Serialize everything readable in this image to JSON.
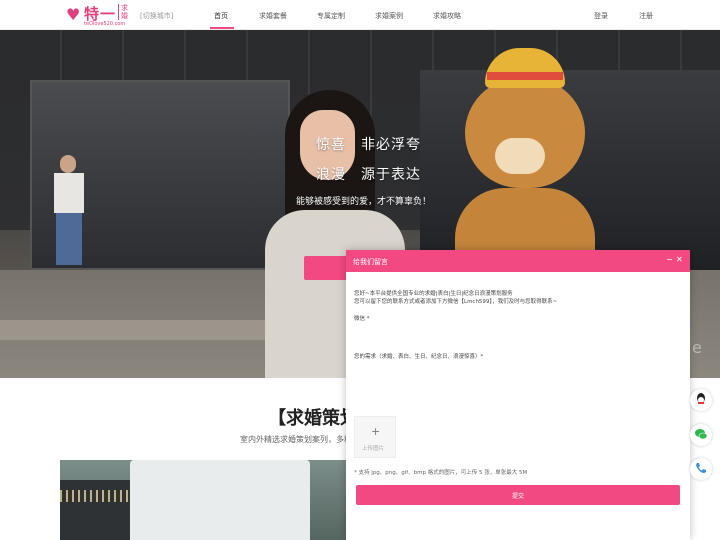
{
  "header": {
    "logo": {
      "mark": "♥",
      "name": "特一",
      "sub": "求婚",
      "url": "teOlove520.com"
    },
    "city_switch": "[切换城市]",
    "nav": [
      {
        "label": "首页",
        "active": true
      },
      {
        "label": "求婚套餐",
        "active": false
      },
      {
        "label": "专属定制",
        "active": false
      },
      {
        "label": "求婚案例",
        "active": false
      },
      {
        "label": "求婚攻略",
        "active": false
      }
    ],
    "login": "登录",
    "register": "注册"
  },
  "hero": {
    "line1": "惊喜　非必浮夸",
    "line2": "浪漫　源于表达",
    "subtitle": "能够被感受到的爱，才不算辜负！"
  },
  "section": {
    "title": "【求婚策划",
    "desc": "室内外精选求婚策划案列，多种"
  },
  "panel": {
    "title": "给我们留言",
    "minimize": "−",
    "close": "✕",
    "intro1": "您好~本平台提供全国专业的求婚|表白|生日|纪念日浪漫策划服务",
    "intro2": "您可以留下您的联系方式或者添加下方微信【Lmch599】，我们及时与您取得联系~",
    "wechat_label": "微信 *",
    "needs_label": "您的需求（求婚、表白、生日、纪念日、浪漫惊喜）*",
    "upload_plus": "+",
    "upload_label": "上传图片",
    "upload_hint": "* 支持 jpg、png、gif、bmp 格式的图片，可上传 5 张，单张最大 5M",
    "submit": "提交"
  },
  "side_icons": [
    "qq-icon",
    "wechat-icon",
    "phone-icon"
  ],
  "colors": {
    "accent": "#f24983",
    "brand": "#e0407f"
  }
}
